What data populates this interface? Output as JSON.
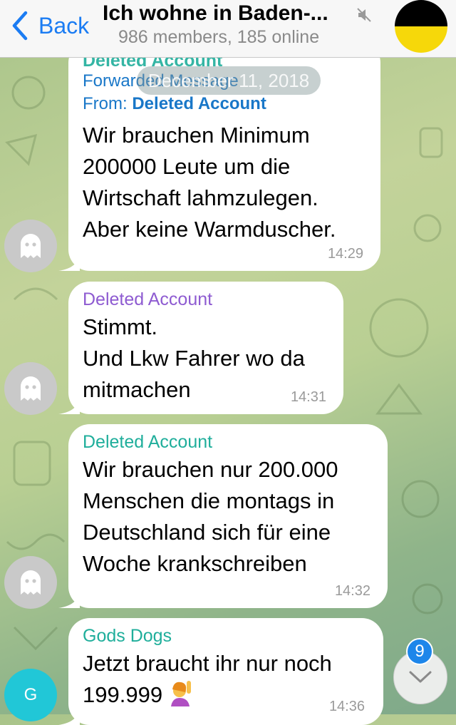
{
  "header": {
    "back_label": "Back",
    "title": "Ich wohne in Baden-...",
    "subtitle": "986 members, 185 online",
    "flag_colors": [
      "#000000",
      "#f6d80a"
    ]
  },
  "date_pill": "December 11, 2018",
  "messages": [
    {
      "sender": "Deleted Account",
      "forwarded_label": "Forwarded Message",
      "from_label": "From:",
      "from_name": "Deleted Account",
      "text": "Wir brauchen Minimum\n200000 Leute um die\nWirtschaft lahmzulegen.\nAber keine Warmduscher.",
      "time": "14:29"
    },
    {
      "sender": "Deleted Account",
      "sender_color": "#8e5bd1",
      "text": "Stimmt.\nUnd Lkw Fahrer wo da\nmitmachen",
      "time": "14:31"
    },
    {
      "sender": "Deleted Account",
      "sender_color": "#1fae9b",
      "text": "Wir brauchen nur 200.000\nMenschen die montags in\nDeutschland sich für eine\nWoche krankschreiben",
      "time": "14:32"
    },
    {
      "sender": "Gods Dogs",
      "sender_color": "#1fae9b",
      "text_line1": "Jetzt braucht ihr nur noch",
      "text_line2": "199.999",
      "time": "14:36",
      "avatar_letter": "G"
    }
  ],
  "unread_badge": "9",
  "colors": {
    "accent": "#1b7cf3",
    "badge": "#1d86ea"
  }
}
